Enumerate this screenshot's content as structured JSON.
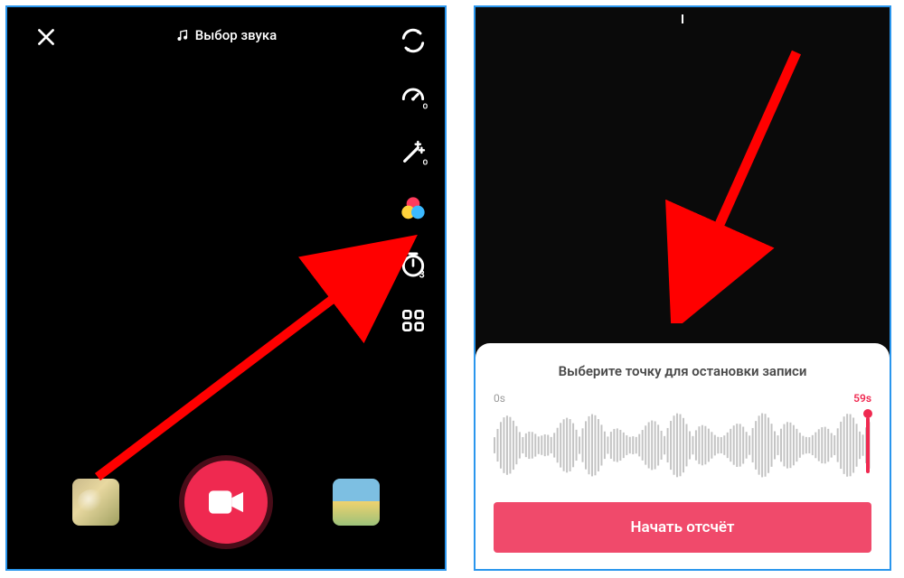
{
  "left_screen": {
    "sound_select_label": "Выбор звука",
    "tools": {
      "flip": "flip-camera-icon",
      "speed": "speed-off-icon",
      "beauty": "beauty-off-icon",
      "filters": "filters-icon",
      "timer": "timer-3s-icon",
      "more": "more-grid-icon"
    }
  },
  "right_screen": {
    "panel_title": "Выберите точку для остановки записи",
    "waveform": {
      "start_label": "0s",
      "end_label": "59s",
      "handle_position_seconds": 59,
      "total_seconds": 59
    },
    "start_button_label": "Начать отсчёт"
  },
  "colors": {
    "accent": "#ef2950",
    "button": "#f04a6b",
    "border": "#2a96ed"
  }
}
